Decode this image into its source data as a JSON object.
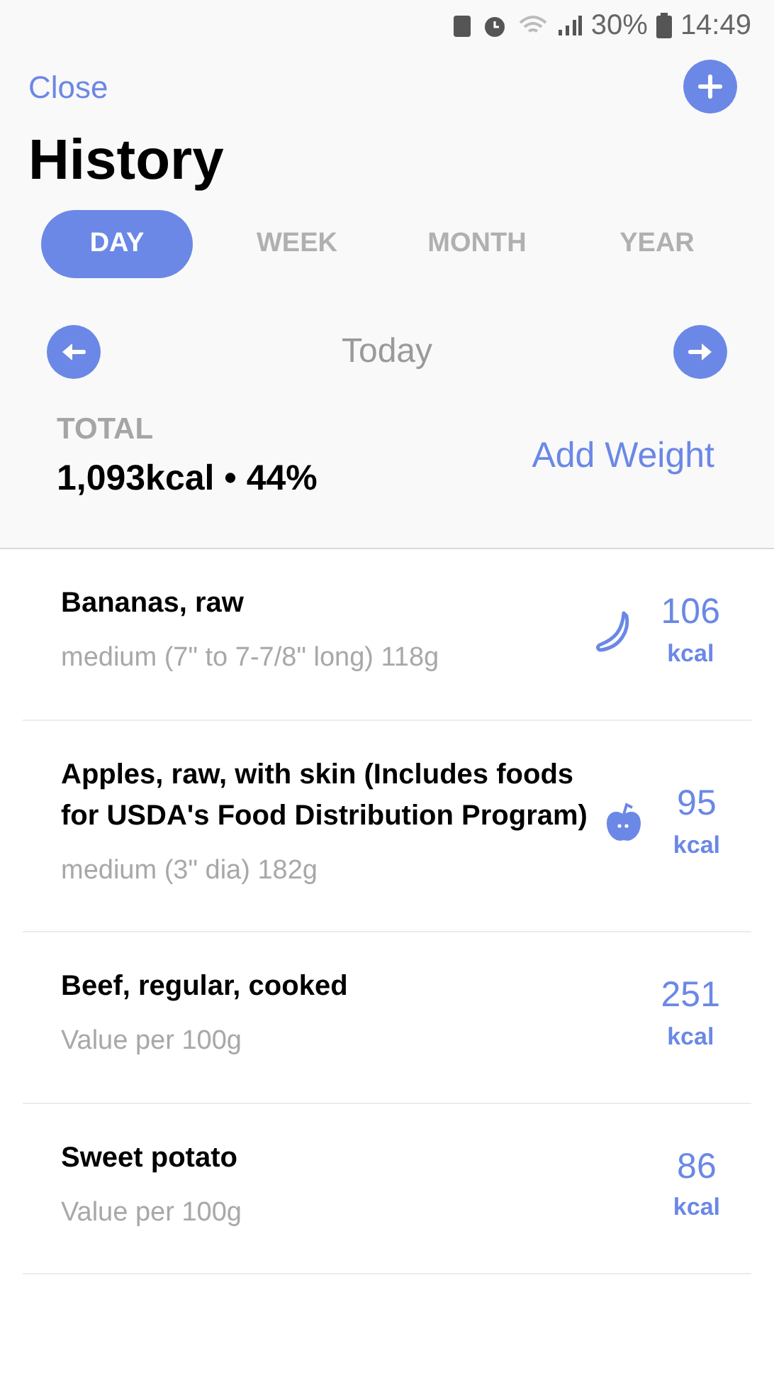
{
  "status_bar": {
    "battery": "30%",
    "time": "14:49"
  },
  "header": {
    "close": "Close",
    "title": "History"
  },
  "tabs": [
    {
      "label": "DAY",
      "selected": true
    },
    {
      "label": "WEEK",
      "selected": false
    },
    {
      "label": "MONTH",
      "selected": false
    },
    {
      "label": "YEAR",
      "selected": false
    }
  ],
  "date_nav": {
    "label": "Today"
  },
  "summary": {
    "label": "TOTAL",
    "value": "1,093kcal • 44%",
    "action": "Add Weight"
  },
  "foods": [
    {
      "kind": "banana",
      "name": "Bananas, raw",
      "portion": "medium (7\" to 7-7/8\" long) 118g",
      "calories": "106",
      "unit": "kcal"
    },
    {
      "kind": "apple",
      "name": "Apples, raw, with skin (Includes foods for USDA's Food Distribution Program)",
      "portion": "medium (3\" dia) 182g",
      "calories": "95",
      "unit": "kcal"
    },
    {
      "kind": "plain",
      "name": "Beef, regular, cooked",
      "portion": "Value per 100g",
      "calories": "251",
      "unit": "kcal"
    },
    {
      "kind": "plain",
      "name": "Sweet potato",
      "portion": "Value per 100g",
      "calories": "86",
      "unit": "kcal"
    }
  ]
}
